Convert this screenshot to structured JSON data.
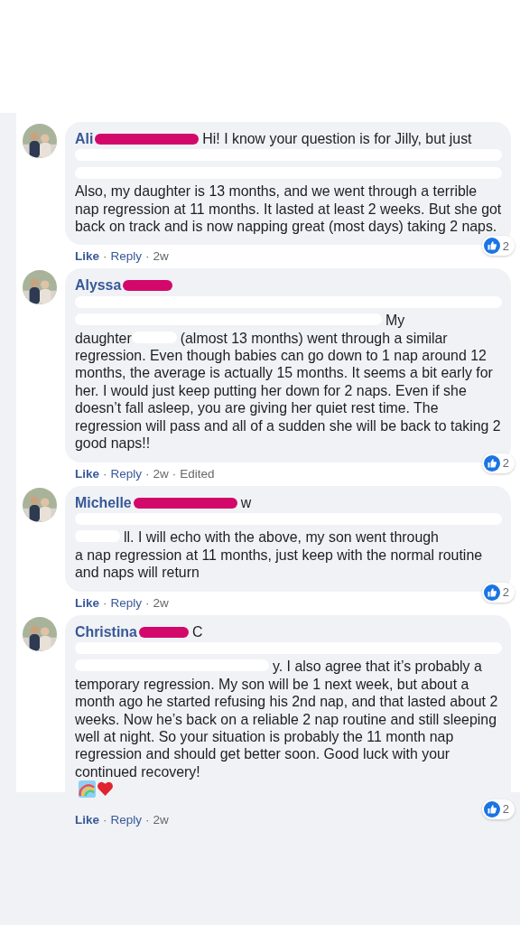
{
  "comments": [
    {
      "name": "Ali",
      "body": [
        {
          "kind": "scribble"
        },
        {
          "kind": "line",
          "text": "Hi! I know your question is for Jilly, but just"
        },
        {
          "kind": "blot_line"
        },
        {
          "kind": "blot_line"
        },
        {
          "kind": "para",
          "text": "Also, my daughter is 13 months, and we went through a terrible nap regression at 11 months. It lasted at least 2 weeks. But she got back on track and is now napping great (most days) taking 2 naps."
        }
      ],
      "actions": [
        "Like",
        "Reply",
        "2w"
      ],
      "separator": "·",
      "reactions": "2"
    },
    {
      "name": "Alyssa",
      "body": [
        {
          "kind": "scribble_short"
        },
        {
          "kind": "blot_line"
        },
        {
          "kind": "blot_long"
        },
        {
          "kind": "line",
          "text": "My"
        },
        {
          "kind": "newline"
        },
        {
          "kind": "line",
          "text": "daughter"
        },
        {
          "kind": "blot"
        },
        {
          "kind": "line",
          "text": "(almost 13 months) went through a similar"
        },
        {
          "kind": "para",
          "text": "regression. Even though babies can go down to 1 nap around 12 months, the average is actually 15 months. It seems a bit early for her. I would just keep putting her down for 2 naps. Even if she doesn’t fall asleep, you are giving her quiet rest time. The regression will pass and all of a sudden she will be back to taking 2 good naps!!"
        }
      ],
      "actions": [
        "Like",
        "Reply",
        "2w",
        "Edited"
      ],
      "separator": "·",
      "reactions": "2"
    },
    {
      "name": "Michelle",
      "body": [
        {
          "kind": "scribble"
        },
        {
          "kind": "line",
          "text": "w"
        },
        {
          "kind": "blot_line"
        },
        {
          "kind": "blot"
        },
        {
          "kind": "line",
          "text": "ll. I will echo with the above, my son went through"
        },
        {
          "kind": "para",
          "text": "a nap regression at 11 months, just keep with the normal routine and naps will return"
        }
      ],
      "actions": [
        "Like",
        "Reply",
        "2w"
      ],
      "separator": "·",
      "reactions": "2"
    },
    {
      "name": "Christina",
      "body": [
        {
          "kind": "scribble_short"
        },
        {
          "kind": "line",
          "text": "C"
        },
        {
          "kind": "blot_line"
        },
        {
          "kind": "blot_wide"
        },
        {
          "kind": "line",
          "text": "y. I also agree that it’s probably a"
        },
        {
          "kind": "para",
          "text": "temporary regression. My son will be 1 next week, but about a month ago he started refusing his 2nd nap, and that lasted about 2 weeks. Now he’s back on a reliable 2 nap routine and still sleeping well at night. So your situation is probably the 11 month nap regression and should get better soon. Good luck with your continued recovery!"
        },
        {
          "kind": "emoji"
        }
      ],
      "actions": [
        "Like",
        "Reply",
        "2w"
      ],
      "separator": "·",
      "reactions": "2"
    }
  ]
}
